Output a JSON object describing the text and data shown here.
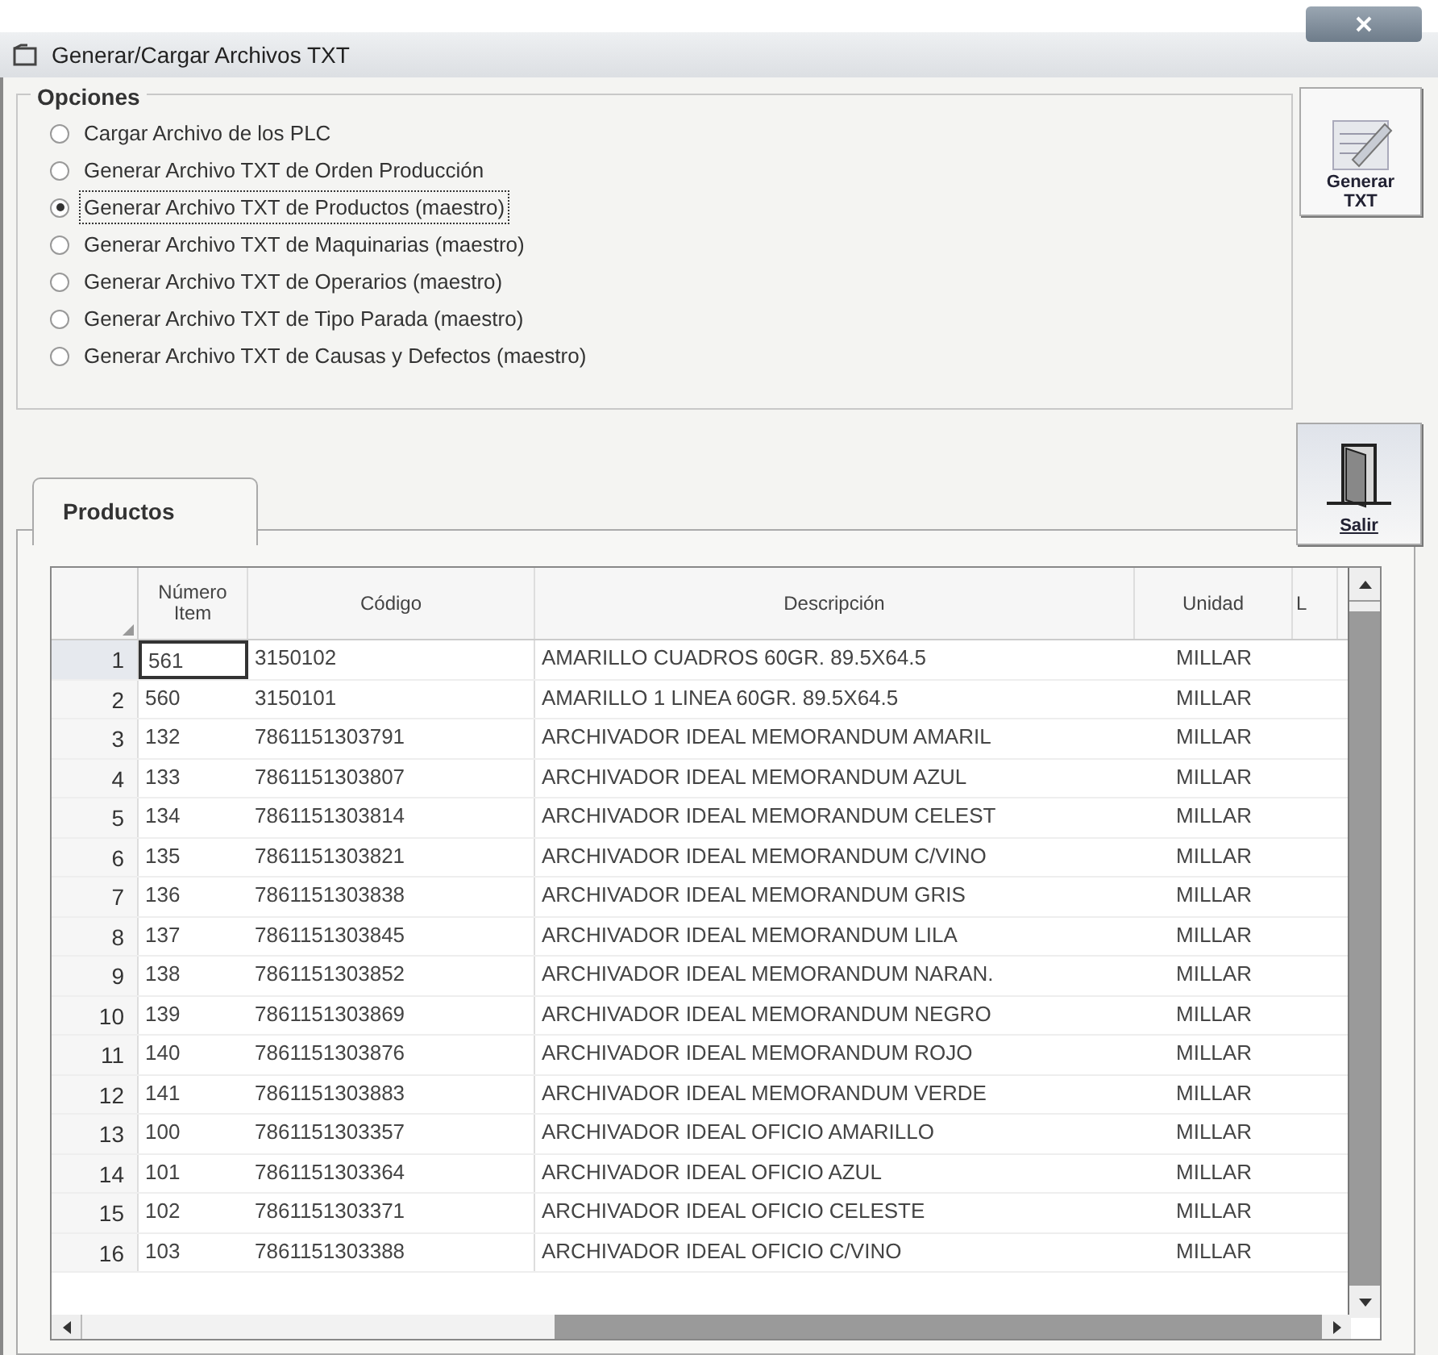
{
  "window": {
    "title": "Generar/Cargar Archivos TXT"
  },
  "options": {
    "title": "Opciones",
    "items": [
      {
        "label": "Cargar Archivo de los PLC",
        "selected": false
      },
      {
        "label": "Generar Archivo TXT de Orden Producción",
        "selected": false
      },
      {
        "label": "Generar Archivo TXT de Productos (maestro)",
        "selected": true
      },
      {
        "label": "Generar Archivo TXT de Maquinarias (maestro)",
        "selected": false
      },
      {
        "label": "Generar Archivo TXT de Operarios (maestro)",
        "selected": false
      },
      {
        "label": "Generar Archivo TXT de Tipo Parada (maestro)",
        "selected": false
      },
      {
        "label": "Generar Archivo TXT de Causas y Defectos (maestro)",
        "selected": false
      }
    ]
  },
  "buttons": {
    "generate": [
      "Generar",
      "TXT"
    ],
    "exit": "Salir"
  },
  "tabs": [
    {
      "label": "Productos",
      "selected": true
    }
  ],
  "table": {
    "columns": [
      "Número Item",
      "Código",
      "Descripción",
      "Unidad",
      "L"
    ],
    "rows": [
      {
        "index": "1",
        "cells": [
          "561",
          "3150102",
          "AMARILLO CUADROS 60GR. 89.5X64.5",
          "MILLAR"
        ],
        "current": true
      },
      {
        "index": "2",
        "cells": [
          "560",
          "3150101",
          "AMARILLO 1 LINEA 60GR. 89.5X64.5",
          "MILLAR"
        ],
        "current": false
      },
      {
        "index": "3",
        "cells": [
          "132",
          "7861151303791",
          "ARCHIVADOR IDEAL MEMORANDUM AMARIL",
          "MILLAR"
        ],
        "current": false
      },
      {
        "index": "4",
        "cells": [
          "133",
          "7861151303807",
          "ARCHIVADOR IDEAL MEMORANDUM AZUL",
          "MILLAR"
        ],
        "current": false
      },
      {
        "index": "5",
        "cells": [
          "134",
          "7861151303814",
          "ARCHIVADOR IDEAL MEMORANDUM CELEST",
          "MILLAR"
        ],
        "current": false
      },
      {
        "index": "6",
        "cells": [
          "135",
          "7861151303821",
          "ARCHIVADOR IDEAL MEMORANDUM C/VINO",
          "MILLAR"
        ],
        "current": false
      },
      {
        "index": "7",
        "cells": [
          "136",
          "7861151303838",
          "ARCHIVADOR IDEAL MEMORANDUM GRIS",
          "MILLAR"
        ],
        "current": false
      },
      {
        "index": "8",
        "cells": [
          "137",
          "7861151303845",
          "ARCHIVADOR IDEAL MEMORANDUM LILA",
          "MILLAR"
        ],
        "current": false
      },
      {
        "index": "9",
        "cells": [
          "138",
          "7861151303852",
          "ARCHIVADOR IDEAL MEMORANDUM NARAN.",
          "MILLAR"
        ],
        "current": false
      },
      {
        "index": "10",
        "cells": [
          "139",
          "7861151303869",
          "ARCHIVADOR IDEAL MEMORANDUM NEGRO",
          "MILLAR"
        ],
        "current": false
      },
      {
        "index": "11",
        "cells": [
          "140",
          "7861151303876",
          "ARCHIVADOR IDEAL MEMORANDUM ROJO",
          "MILLAR"
        ],
        "current": false
      },
      {
        "index": "12",
        "cells": [
          "141",
          "7861151303883",
          "ARCHIVADOR IDEAL MEMORANDUM VERDE",
          "MILLAR"
        ],
        "current": false
      },
      {
        "index": "13",
        "cells": [
          "100",
          "7861151303357",
          "ARCHIVADOR IDEAL OFICIO AMARILLO",
          "MILLAR"
        ],
        "current": false
      },
      {
        "index": "14",
        "cells": [
          "101",
          "7861151303364",
          "ARCHIVADOR IDEAL OFICIO AZUL",
          "MILLAR"
        ],
        "current": false
      },
      {
        "index": "15",
        "cells": [
          "102",
          "7861151303371",
          "ARCHIVADOR IDEAL OFICIO CELESTE",
          "MILLAR"
        ],
        "current": false
      },
      {
        "index": "16",
        "cells": [
          "103",
          "7861151303388",
          "ARCHIVADOR IDEAL OFICIO C/VINO",
          "MILLAR"
        ],
        "current": false
      }
    ]
  }
}
